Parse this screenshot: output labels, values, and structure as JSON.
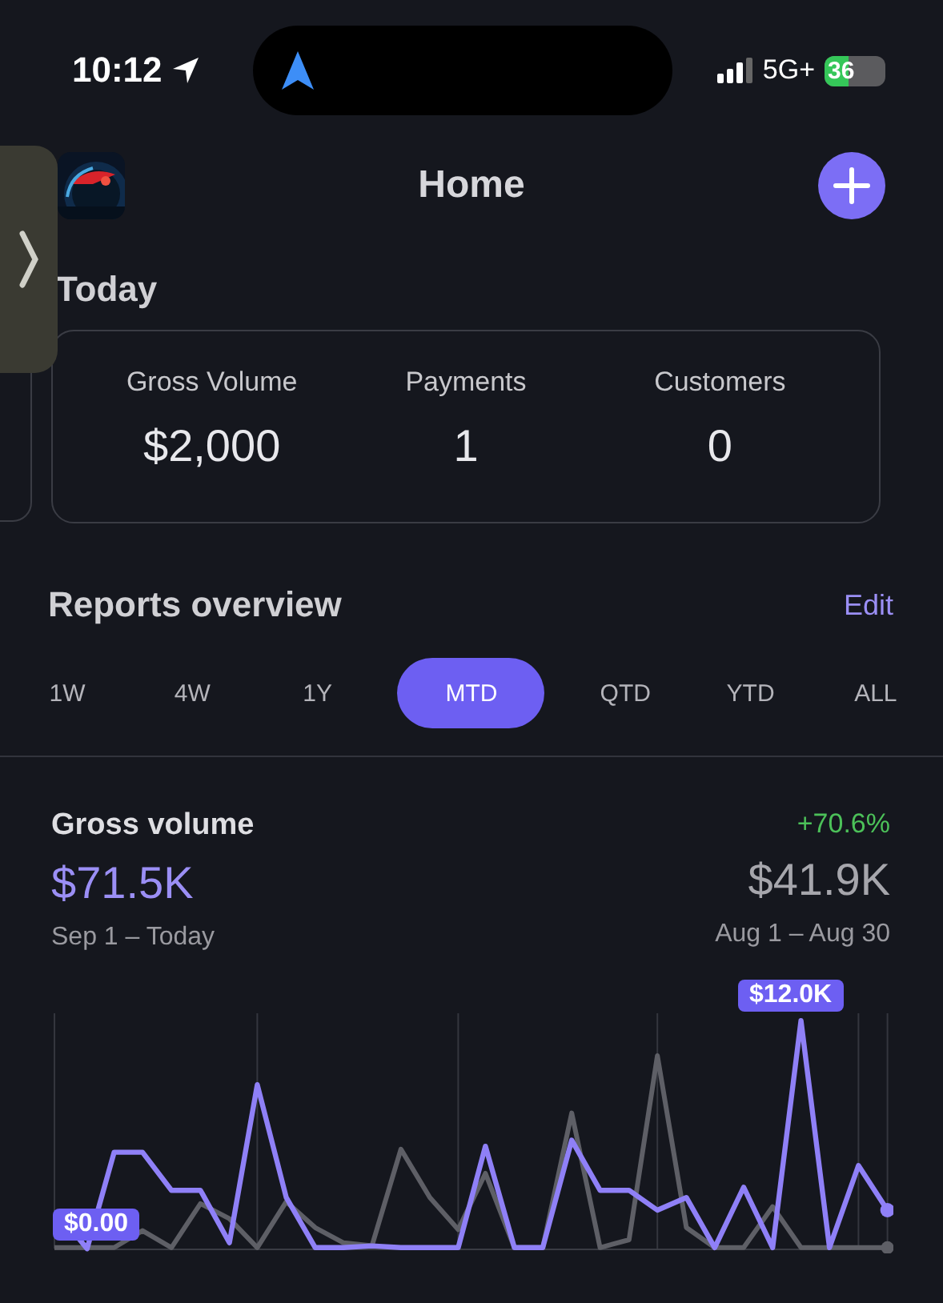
{
  "status_bar": {
    "time": "10:12",
    "network": "5G+",
    "battery": "36"
  },
  "header": {
    "title": "Home"
  },
  "today": {
    "title": "Today",
    "stats": [
      {
        "label": "Gross Volume",
        "value": "$2,000"
      },
      {
        "label": "Payments",
        "value": "1"
      },
      {
        "label": "Customers",
        "value": "0"
      }
    ]
  },
  "reports": {
    "title": "Reports overview",
    "edit": "Edit",
    "ranges": [
      {
        "label": "1W",
        "selected": false
      },
      {
        "label": "4W",
        "selected": false
      },
      {
        "label": "1Y",
        "selected": false
      },
      {
        "label": "MTD",
        "selected": true
      },
      {
        "label": "QTD",
        "selected": false
      },
      {
        "label": "YTD",
        "selected": false
      },
      {
        "label": "ALL",
        "selected": false
      }
    ]
  },
  "gross_volume": {
    "title": "Gross volume",
    "change": "+70.6%",
    "current": "$71.5K",
    "current_period": "Sep 1 – Today",
    "previous": "$41.9K",
    "previous_period": "Aug 1 – Aug 30",
    "peak_label": "$12.0K",
    "start_label": "$0.00"
  }
}
